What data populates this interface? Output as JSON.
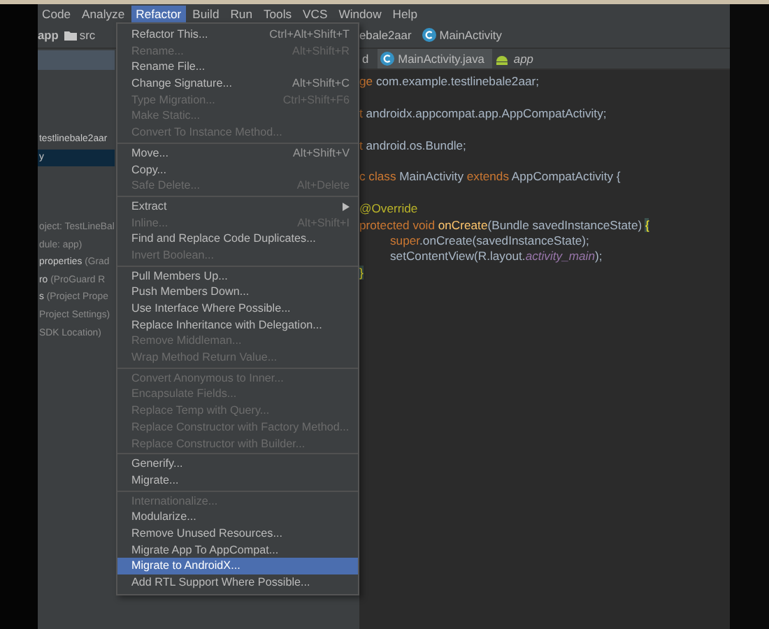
{
  "menubar": [
    {
      "label": "Code",
      "selected": false
    },
    {
      "label": "Analyze",
      "selected": false
    },
    {
      "label": "Refactor",
      "selected": true
    },
    {
      "label": "Build",
      "selected": false
    },
    {
      "label": "Run",
      "selected": false
    },
    {
      "label": "Tools",
      "selected": false
    },
    {
      "label": "VCS",
      "selected": false
    },
    {
      "label": "Window",
      "selected": false
    },
    {
      "label": "Help",
      "selected": false
    }
  ],
  "breadcrumb": {
    "left": [
      "app",
      "src"
    ],
    "right": [
      "ebale2aar",
      "MainActivity"
    ]
  },
  "project_panel": {
    "modules": [
      {
        "name": "testlinebale2aar",
        "selected": false
      },
      {
        "name": "y",
        "selected": true
      }
    ],
    "gradle_files": [
      {
        "note": "oject: TestLineBal"
      },
      {
        "note": "dule: app)"
      },
      {
        "name": "properties",
        "note": "(Grad"
      },
      {
        "name": "ro",
        "note": "(ProGuard R"
      },
      {
        "name": "s",
        "note": "(Project Prope"
      },
      {
        "note": "Project Settings)"
      },
      {
        "note": "SDK Location)"
      }
    ]
  },
  "editor_tabs": [
    {
      "label": "d",
      "kind": "plain",
      "selected": false
    },
    {
      "label": "MainActivity.java",
      "kind": "class",
      "selected": true
    },
    {
      "label": "app",
      "kind": "module",
      "selected": false
    }
  ],
  "code": [
    {
      "kind": "line",
      "tokens": [
        {
          "kind": "keyword",
          "text": "ge"
        },
        {
          "kind": "plain",
          "text": " com.example.testlinebale2aar;"
        }
      ]
    },
    {
      "kind": "blank"
    },
    {
      "kind": "line",
      "tokens": [
        {
          "kind": "keyword",
          "text": "t"
        },
        {
          "kind": "plain",
          "text": " androidx.appcompat.app.AppCompatActivity;"
        }
      ]
    },
    {
      "kind": "blank"
    },
    {
      "kind": "line",
      "tokens": [
        {
          "kind": "keyword",
          "text": "t"
        },
        {
          "kind": "plain",
          "text": " android.os.Bundle;"
        }
      ]
    },
    {
      "kind": "blank"
    },
    {
      "kind": "line",
      "tokens": [
        {
          "kind": "keyword",
          "text": "c class"
        },
        {
          "kind": "plain",
          "text": " MainActivity "
        },
        {
          "kind": "keyword",
          "text": "extends"
        },
        {
          "kind": "plain",
          "text": " AppCompatActivity {"
        }
      ]
    },
    {
      "kind": "blank"
    },
    {
      "kind": "line",
      "tokens": [
        {
          "kind": "annotation",
          "text": "@Override"
        }
      ]
    },
    {
      "kind": "line",
      "tokens": [
        {
          "kind": "keyword",
          "text": "protected void"
        },
        {
          "kind": "method",
          "text": " onCreate"
        },
        {
          "kind": "plain",
          "text": "(Bundle savedInstanceState) "
        },
        {
          "kind": "brace",
          "text": "{"
        }
      ],
      "children": [
        {
          "kind": "line",
          "tokens": [
            {
              "kind": "keyword",
              "text": "super"
            },
            {
              "kind": "plain",
              "text": ".onCreate(savedInstanceState);"
            }
          ]
        },
        {
          "kind": "line",
          "tokens": [
            {
              "kind": "plain",
              "text": "setContentView(R.layout."
            },
            {
              "kind": "field",
              "text": "activity_main"
            },
            {
              "kind": "plain",
              "text": ");"
            }
          ]
        }
      ]
    },
    {
      "kind": "line",
      "tokens": [
        {
          "kind": "brace",
          "text": "}"
        }
      ]
    }
  ],
  "refactor_menu": [
    {
      "kind": "item",
      "label": "Refactor This...",
      "shortcut": "Ctrl+Alt+Shift+T",
      "disabled": false,
      "selected": false
    },
    {
      "kind": "item",
      "label": "Rename...",
      "shortcut": "Alt+Shift+R",
      "disabled": true,
      "selected": false
    },
    {
      "kind": "item",
      "label": "Rename File...",
      "disabled": false,
      "selected": false
    },
    {
      "kind": "item",
      "label": "Change Signature...",
      "shortcut": "Alt+Shift+C",
      "disabled": false,
      "selected": false
    },
    {
      "kind": "item",
      "label": "Type Migration...",
      "shortcut": "Ctrl+Shift+F6",
      "disabled": true,
      "selected": false
    },
    {
      "kind": "item",
      "label": "Make Static...",
      "disabled": true,
      "selected": false
    },
    {
      "kind": "item",
      "label": "Convert To Instance Method...",
      "disabled": true,
      "selected": false
    },
    {
      "kind": "separator"
    },
    {
      "kind": "item",
      "label": "Move...",
      "shortcut": "Alt+Shift+V",
      "disabled": false,
      "selected": false
    },
    {
      "kind": "item",
      "label": "Copy...",
      "disabled": false,
      "selected": false
    },
    {
      "kind": "item",
      "label": "Safe Delete...",
      "shortcut": "Alt+Delete",
      "disabled": true,
      "selected": false
    },
    {
      "kind": "separator"
    },
    {
      "kind": "submenu",
      "label": "Extract",
      "disabled": false,
      "selected": false
    },
    {
      "kind": "item",
      "label": "Inline...",
      "shortcut": "Alt+Shift+I",
      "disabled": true,
      "selected": false
    },
    {
      "kind": "item",
      "label": "Find and Replace Code Duplicates...",
      "disabled": false,
      "selected": false
    },
    {
      "kind": "item",
      "label": "Invert Boolean...",
      "disabled": true,
      "selected": false
    },
    {
      "kind": "separator"
    },
    {
      "kind": "item",
      "label": "Pull Members Up...",
      "disabled": false,
      "selected": false
    },
    {
      "kind": "item",
      "label": "Push Members Down...",
      "disabled": false,
      "selected": false
    },
    {
      "kind": "item",
      "label": "Use Interface Where Possible...",
      "disabled": false,
      "selected": false
    },
    {
      "kind": "item",
      "label": "Replace Inheritance with Delegation...",
      "disabled": false,
      "selected": false
    },
    {
      "kind": "item",
      "label": "Remove Middleman...",
      "disabled": true,
      "selected": false
    },
    {
      "kind": "item",
      "label": "Wrap Method Return Value...",
      "disabled": true,
      "selected": false
    },
    {
      "kind": "separator"
    },
    {
      "kind": "item",
      "label": "Convert Anonymous to Inner...",
      "disabled": true,
      "selected": false
    },
    {
      "kind": "item",
      "label": "Encapsulate Fields...",
      "disabled": true,
      "selected": false
    },
    {
      "kind": "item",
      "label": "Replace Temp with Query...",
      "disabled": true,
      "selected": false
    },
    {
      "kind": "item",
      "label": "Replace Constructor with Factory Method...",
      "disabled": true,
      "selected": false
    },
    {
      "kind": "item",
      "label": "Replace Constructor with Builder...",
      "disabled": true,
      "selected": false
    },
    {
      "kind": "separator"
    },
    {
      "kind": "item",
      "label": "Generify...",
      "disabled": false,
      "selected": false
    },
    {
      "kind": "item",
      "label": "Migrate...",
      "disabled": false,
      "selected": false
    },
    {
      "kind": "separator"
    },
    {
      "kind": "item",
      "label": "Internationalize...",
      "disabled": true,
      "selected": false
    },
    {
      "kind": "item",
      "label": "Modularize...",
      "disabled": false,
      "selected": false
    },
    {
      "kind": "item",
      "label": "Remove Unused Resources...",
      "disabled": false,
      "selected": false
    },
    {
      "kind": "item",
      "label": "Migrate App To AppCompat...",
      "disabled": false,
      "selected": false
    },
    {
      "kind": "item",
      "label": "Migrate to AndroidX...",
      "disabled": false,
      "selected": true
    },
    {
      "kind": "item",
      "label": "Add RTL Support Where Possible...",
      "disabled": false,
      "selected": false
    }
  ]
}
